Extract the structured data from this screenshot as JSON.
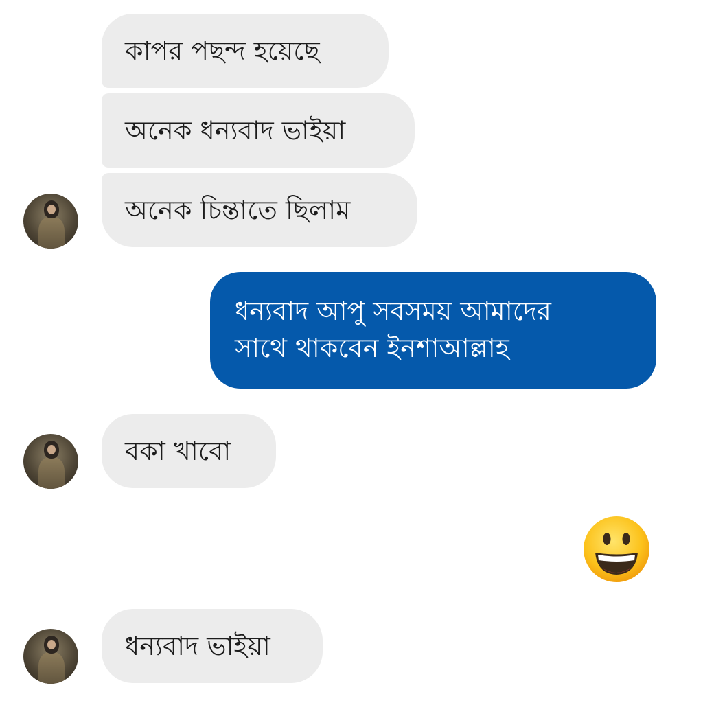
{
  "messages": {
    "incoming_1": "কাপর পছন্দ হয়েছে",
    "incoming_2": "অনেক ধন্যবাদ ভাইয়া",
    "incoming_3": "অনেক চিন্তাতে ছিলাম",
    "outgoing_1": {
      "line1": "ধন্যবাদ আপু সবসময় আমাদের",
      "line2": "সাথে থাকবেন ইনশাআল্লাহ"
    },
    "incoming_4": "বকা খাবো",
    "outgoing_emoji": "grinning-face-emoji",
    "incoming_5": "ধন্যবাদ ভাইয়া"
  },
  "colors": {
    "incoming_bubble": "#ececec",
    "outgoing_bubble": "#0559ab",
    "incoming_text": "#1c1c1c",
    "outgoing_text": "#ffffff"
  },
  "icons": {
    "avatar": "contact-avatar",
    "emoji": "grinning-face-icon"
  }
}
